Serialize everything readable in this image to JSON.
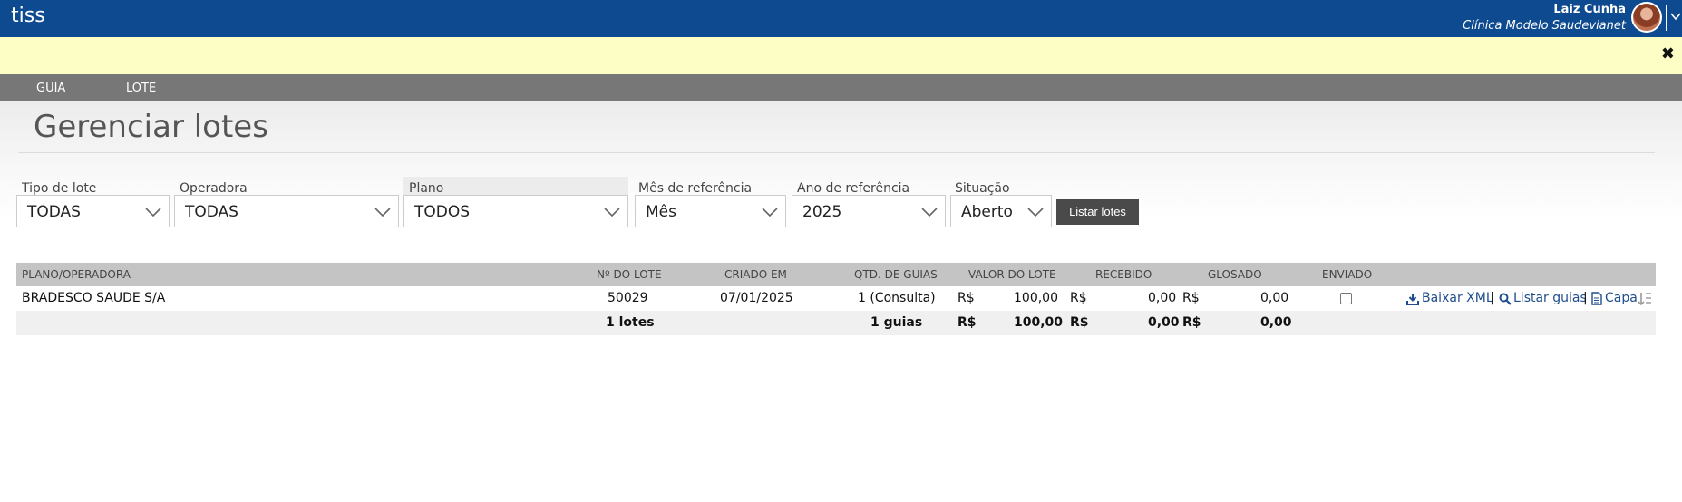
{
  "app": {
    "brand": "tiss"
  },
  "user": {
    "name": "Laiz Cunha",
    "clinic": "Clínica Modelo Saudevianet"
  },
  "notice": {
    "close_glyph": "✖"
  },
  "menu": {
    "items": [
      {
        "label": "GUIA"
      },
      {
        "label": "LOTE"
      }
    ]
  },
  "page": {
    "title": "Gerenciar lotes"
  },
  "filters": {
    "tipo_lote": {
      "label": "Tipo de lote",
      "value": "TODAS"
    },
    "operadora": {
      "label": "Operadora",
      "value": "TODAS"
    },
    "plano": {
      "label": "Plano",
      "value": "TODOS"
    },
    "mes": {
      "label": "Mês de referência",
      "value": "Mês"
    },
    "ano": {
      "label": "Ano de referência",
      "value": "2025"
    },
    "situacao": {
      "label": "Situação",
      "value": "Aberto"
    },
    "submit_label": "Listar lotes"
  },
  "table": {
    "columns": [
      "PLANO/OPERADORA",
      "Nº DO LOTE",
      "CRIADO EM",
      "QTD. DE GUIAS",
      "VALOR DO LOTE",
      "RECEBIDO",
      "GLOSADO",
      "ENVIADO"
    ],
    "currency": "R$",
    "rows": [
      {
        "plano_operadora": "BRADESCO SAUDE S/A",
        "numero_lote": "50029",
        "criado_em": "07/01/2025",
        "qtd_guias": "1 (Consulta)",
        "valor_lote": "100,00",
        "recebido": "0,00",
        "glosado": "0,00",
        "enviado": false
      }
    ],
    "actions": {
      "download": "Baixar XML",
      "list": "Listar guias",
      "cover": "Capa",
      "separator": "|"
    },
    "totals": {
      "lotes": "1 lotes",
      "guias": "1 guias",
      "valor_lote": "100,00",
      "recebido": "0,00",
      "glosado": "0,00"
    }
  },
  "colors": {
    "topbar": "#0d4a8f",
    "notice": "#fdfdc6",
    "menubar": "#777777",
    "button": "#4a4a4a",
    "link": "#1f4e8c",
    "table_header": "#c4c4c4"
  }
}
